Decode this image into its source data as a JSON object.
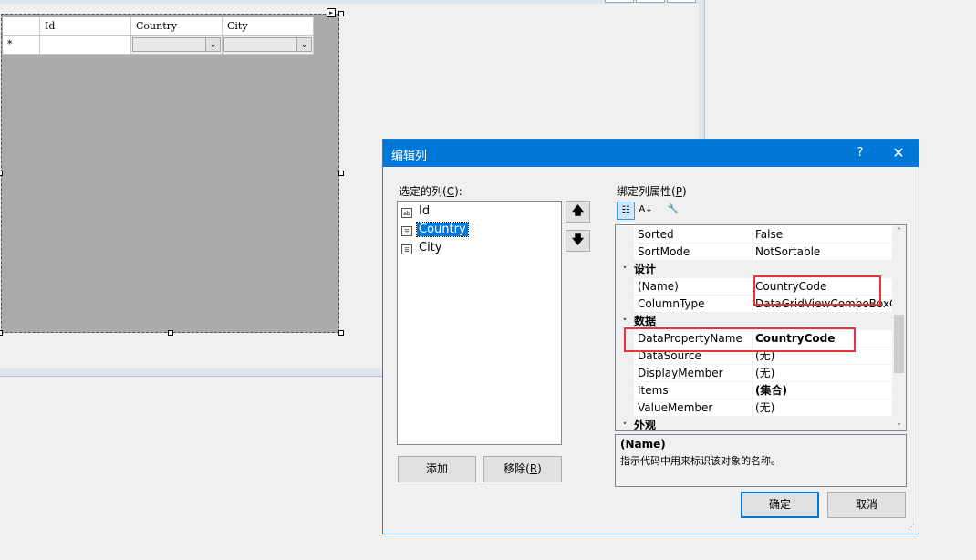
{
  "grid": {
    "row_header_marker": "*",
    "columns": [
      "Id",
      "Country",
      "City"
    ]
  },
  "dialog": {
    "title": "编辑列",
    "help": "?",
    "close": "✕",
    "selected_columns_label": "选定的列(",
    "selected_columns_key": "C",
    "selected_columns_suffix": "):",
    "columns": [
      {
        "icon": "textbox-column-icon",
        "label": "Id",
        "selected": false
      },
      {
        "icon": "combobox-column-icon",
        "label": "Country",
        "selected": true
      },
      {
        "icon": "combobox-column-icon",
        "label": "City",
        "selected": false
      }
    ],
    "move_up": "🡅",
    "move_down": "🡇",
    "add_button": "添加",
    "remove_button": "移除(",
    "remove_key": "R",
    "remove_suffix": ")",
    "properties_label": "绑定列属性(",
    "properties_key": "P",
    "properties_suffix": ")",
    "ok_button": "确定",
    "cancel_button": "取消"
  },
  "property_grid": {
    "rows": [
      {
        "type": "prop",
        "name": "Sorted",
        "value": "False",
        "bold": false
      },
      {
        "type": "prop",
        "name": "SortMode",
        "value": "NotSortable",
        "bold": false
      },
      {
        "type": "category",
        "name": "设计"
      },
      {
        "type": "prop",
        "name": "(Name)",
        "value": "CountryCode",
        "bold": false
      },
      {
        "type": "prop",
        "name": "ColumnType",
        "value": "DataGridViewComboBoxColumn",
        "bold": false
      },
      {
        "type": "category",
        "name": "数据"
      },
      {
        "type": "prop",
        "name": "DataPropertyName",
        "value": "CountryCode",
        "bold": true
      },
      {
        "type": "prop",
        "name": "DataSource",
        "value": "(无)",
        "bold": false
      },
      {
        "type": "prop",
        "name": "DisplayMember",
        "value": "(无)",
        "bold": false
      },
      {
        "type": "prop",
        "name": "Items",
        "value": "(集合)",
        "bold": true
      },
      {
        "type": "prop",
        "name": "ValueMember",
        "value": "(无)",
        "bold": false
      },
      {
        "type": "category",
        "name": "外观"
      }
    ],
    "description_title": "(Name)",
    "description_text": "指示代码中用来标识该对象的名称。"
  }
}
